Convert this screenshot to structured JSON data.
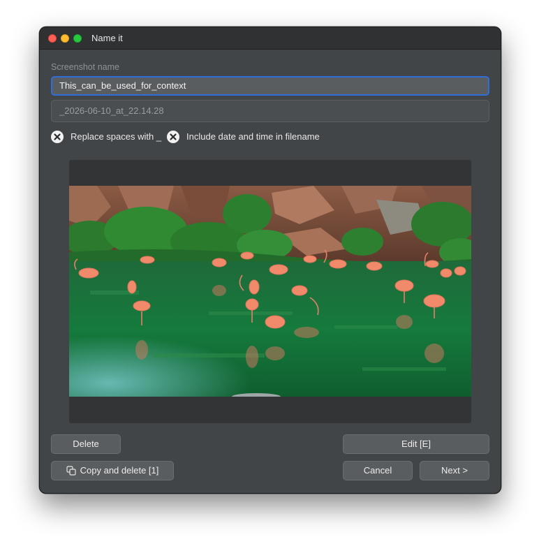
{
  "window": {
    "title": "Name it"
  },
  "form": {
    "name_label": "Screenshot name",
    "name_value": "This_can_be_used_for_context",
    "suffix_value": "_2026-06-10_at_22.14.28"
  },
  "options": {
    "replace_spaces": {
      "label": "Replace spaces with _",
      "checked": true
    },
    "include_datetime": {
      "label": "Include date and time in filename",
      "checked": true
    }
  },
  "preview": {
    "description": "flamingos-in-green-lagoon-photo"
  },
  "buttons": {
    "delete": "Delete",
    "edit": "Edit [E]",
    "copy_delete": "Copy and delete [1]",
    "cancel": "Cancel",
    "next": "Next >"
  },
  "icons": {
    "checkbox": "x-mark-icon",
    "copy": "copy-icon"
  },
  "colors": {
    "accent": "#2f6ed8",
    "window_bg": "#424547",
    "titlebar_bg": "#2f3133",
    "button_bg": "#5a5d60"
  }
}
